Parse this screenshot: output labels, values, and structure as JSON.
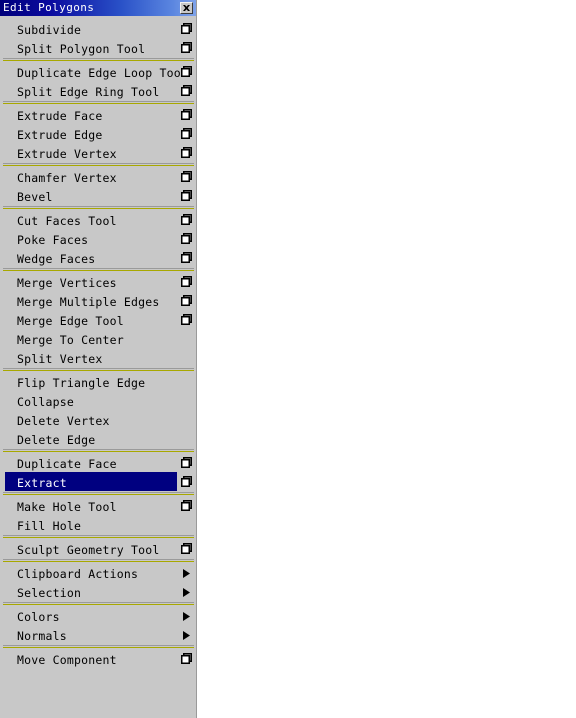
{
  "window": {
    "title": "Edit Polygons",
    "close_label": "x",
    "title_gradient_start": "#00007b",
    "title_gradient_end": "#7fa3ea",
    "panel_bg": "#c8c8c8",
    "highlight_bg": "#000080",
    "separator_color": "#a8a800"
  },
  "menu": {
    "groups": [
      {
        "items": [
          {
            "label": "Subdivide",
            "option_box": true,
            "submenu": false,
            "highlighted": false
          },
          {
            "label": "Split Polygon Tool",
            "option_box": true,
            "submenu": false,
            "highlighted": false
          }
        ]
      },
      {
        "items": [
          {
            "label": "Duplicate Edge Loop Tool",
            "option_box": true,
            "submenu": false,
            "highlighted": false
          },
          {
            "label": "Split Edge Ring Tool",
            "option_box": true,
            "submenu": false,
            "highlighted": false
          }
        ]
      },
      {
        "items": [
          {
            "label": "Extrude Face",
            "option_box": true,
            "submenu": false,
            "highlighted": false
          },
          {
            "label": "Extrude Edge",
            "option_box": true,
            "submenu": false,
            "highlighted": false
          },
          {
            "label": "Extrude Vertex",
            "option_box": true,
            "submenu": false,
            "highlighted": false
          }
        ]
      },
      {
        "items": [
          {
            "label": "Chamfer Vertex",
            "option_box": true,
            "submenu": false,
            "highlighted": false
          },
          {
            "label": "Bevel",
            "option_box": true,
            "submenu": false,
            "highlighted": false
          }
        ]
      },
      {
        "items": [
          {
            "label": "Cut Faces Tool",
            "option_box": true,
            "submenu": false,
            "highlighted": false
          },
          {
            "label": "Poke Faces",
            "option_box": true,
            "submenu": false,
            "highlighted": false
          },
          {
            "label": "Wedge Faces",
            "option_box": true,
            "submenu": false,
            "highlighted": false
          }
        ]
      },
      {
        "items": [
          {
            "label": "Merge Vertices",
            "option_box": true,
            "submenu": false,
            "highlighted": false
          },
          {
            "label": "Merge Multiple Edges",
            "option_box": true,
            "submenu": false,
            "highlighted": false
          },
          {
            "label": "Merge Edge Tool",
            "option_box": true,
            "submenu": false,
            "highlighted": false
          },
          {
            "label": "Merge To Center",
            "option_box": false,
            "submenu": false,
            "highlighted": false
          },
          {
            "label": "Split Vertex",
            "option_box": false,
            "submenu": false,
            "highlighted": false
          }
        ]
      },
      {
        "items": [
          {
            "label": "Flip Triangle Edge",
            "option_box": false,
            "submenu": false,
            "highlighted": false
          },
          {
            "label": "Collapse",
            "option_box": false,
            "submenu": false,
            "highlighted": false
          },
          {
            "label": "Delete Vertex",
            "option_box": false,
            "submenu": false,
            "highlighted": false
          },
          {
            "label": "Delete Edge",
            "option_box": false,
            "submenu": false,
            "highlighted": false
          }
        ]
      },
      {
        "items": [
          {
            "label": "Duplicate Face",
            "option_box": true,
            "submenu": false,
            "highlighted": false
          },
          {
            "label": "Extract",
            "option_box": true,
            "submenu": false,
            "highlighted": true
          }
        ]
      },
      {
        "items": [
          {
            "label": "Make Hole Tool",
            "option_box": true,
            "submenu": false,
            "highlighted": false
          },
          {
            "label": "Fill Hole",
            "option_box": false,
            "submenu": false,
            "highlighted": false
          }
        ]
      },
      {
        "items": [
          {
            "label": "Sculpt Geometry Tool",
            "option_box": true,
            "submenu": false,
            "highlighted": false
          }
        ]
      },
      {
        "items": [
          {
            "label": "Clipboard Actions",
            "option_box": false,
            "submenu": true,
            "highlighted": false
          },
          {
            "label": "Selection",
            "option_box": false,
            "submenu": true,
            "highlighted": false
          }
        ]
      },
      {
        "items": [
          {
            "label": "Colors",
            "option_box": false,
            "submenu": true,
            "highlighted": false
          },
          {
            "label": "Normals",
            "option_box": false,
            "submenu": true,
            "highlighted": false
          }
        ]
      },
      {
        "items": [
          {
            "label": "Move Component",
            "option_box": true,
            "submenu": false,
            "highlighted": false
          }
        ]
      }
    ]
  }
}
